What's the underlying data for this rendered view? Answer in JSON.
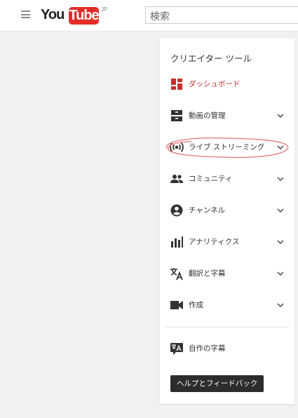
{
  "header": {
    "logo_you": "You",
    "logo_tube": "Tube",
    "logo_region": "JP",
    "search_placeholder": "検索"
  },
  "panel": {
    "title": "クリエイター ツール",
    "items": [
      {
        "label": "ダッシュボード",
        "icon": "dashboard-icon",
        "active": true,
        "has_chevron": false
      },
      {
        "label": "動画の管理",
        "icon": "video-manager-icon",
        "active": false,
        "has_chevron": true
      },
      {
        "label": "ライブ ストリーミング",
        "icon": "live-streaming-icon",
        "active": false,
        "has_chevron": true
      },
      {
        "label": "コミュニティ",
        "icon": "community-icon",
        "active": false,
        "has_chevron": true
      },
      {
        "label": "チャンネル",
        "icon": "channel-icon",
        "active": false,
        "has_chevron": true
      },
      {
        "label": "アナリティクス",
        "icon": "analytics-icon",
        "active": false,
        "has_chevron": true
      },
      {
        "label": "翻訳と字幕",
        "icon": "translate-icon",
        "active": false,
        "has_chevron": true
      },
      {
        "label": "作成",
        "icon": "create-icon",
        "active": false,
        "has_chevron": true
      }
    ],
    "own_subtitles_label": "自作の字幕",
    "help_button_label": "ヘルプとフィードバック"
  },
  "colors": {
    "brand_red": "#e52d27",
    "active_text": "#c4302b",
    "annotation": "#e8898a"
  }
}
